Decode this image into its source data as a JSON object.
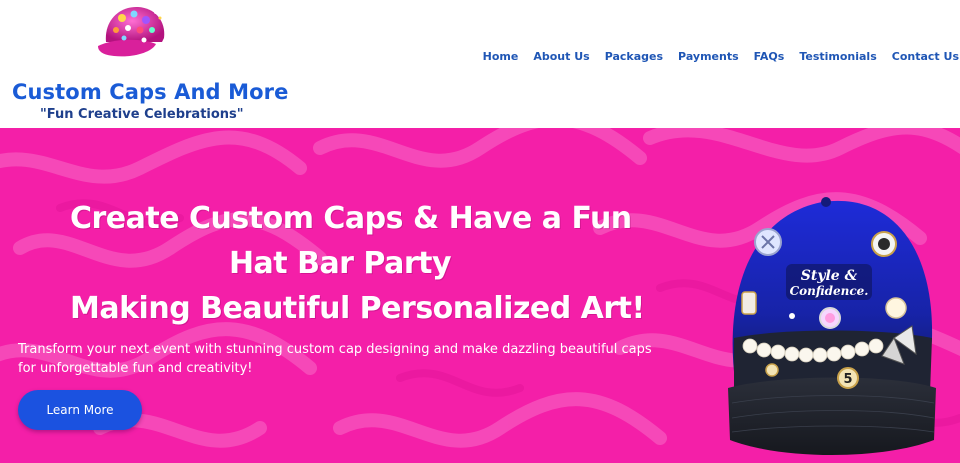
{
  "brand": {
    "title": "Custom Caps And More",
    "tagline": "\"Fun Creative Celebrations\"",
    "logo_icon": "bedazzled-cap-logo"
  },
  "nav": {
    "items": [
      {
        "label": "Home"
      },
      {
        "label": "About Us"
      },
      {
        "label": "Packages"
      },
      {
        "label": "Payments"
      },
      {
        "label": "FAQs"
      },
      {
        "label": "Testimonials"
      },
      {
        "label": "Contact Us"
      }
    ]
  },
  "hero": {
    "headline_line1": "Create Custom Caps & Have a Fun",
    "headline_line2": "Hat Bar Party",
    "headline_line3": "Making Beautiful Personalized Art!",
    "description": "Transform your next event with stunning custom cap designing and make dazzling beautiful caps  for unforgettable fun and creativity!",
    "cta_label": "Learn More",
    "image_patch_text": "Style & Confidence.",
    "image_number": "5"
  },
  "colors": {
    "hero_bg": "#f41fa8",
    "brand_blue": "#1a5bd6",
    "nav_blue": "#1f56b5",
    "button_blue": "#1b52e0"
  }
}
